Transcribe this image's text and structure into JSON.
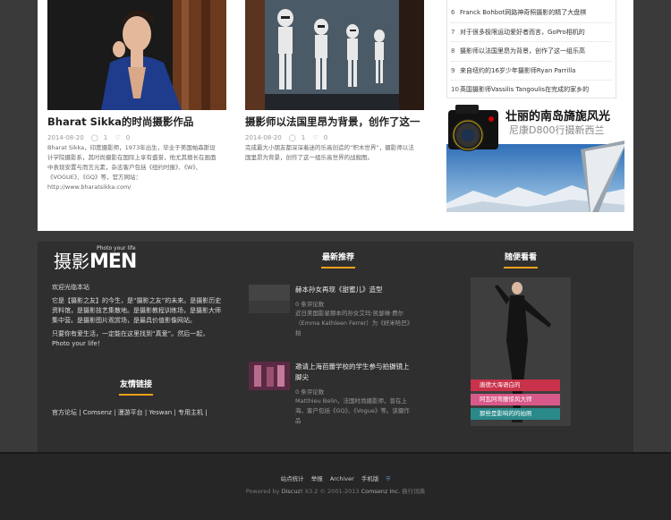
{
  "cards": [
    {
      "title": "Bharat Sikka的时尚摄影作品",
      "date": "2014-08-20",
      "comments": "1",
      "likes": "0",
      "description": "Bharat Sikka，印度摄影师，1973年出生，毕业于美国帕森斯设计学院摄影系，其时尚摄影在国际上享有盛誉，他尤其擅长在画面中表现安置与而言元素，杂志客户包括《纽约时报》、《W》、《VOGUE》、《GQ》等，官方网站：http://www.bharatsikka.com/"
    },
    {
      "title": "摄影师以法国里昂为背景，创作了这一",
      "date": "2014-08-20",
      "comments": "1",
      "likes": "0",
      "description": "完成最大小朋友都深深着迷的乐高创造的“积木世界”，摄影师以法国里昂为背景，创作了这一组乐高世界的战舰图。"
    }
  ],
  "rank": [
    {
      "num": "6",
      "text": "Franck Bohbot网路神奇照摄影的精了大盘棋"
    },
    {
      "num": "7",
      "text": "对于很多极限运动爱好者而言，GoPro相机的"
    },
    {
      "num": "8",
      "text": "摄影师以法国里昂为背景，创作了这一组乐高"
    },
    {
      "num": "9",
      "text": "来自纽约的16岁少年摄影师Ryan Parrilla"
    },
    {
      "num": "10",
      "text": "英国摄影师Vassilis Tangoulis在完成的家乡的"
    }
  ],
  "promo": {
    "headline": "壮丽的南岛旖旎风光",
    "subline": "尼康D800行摄新西兰"
  },
  "logo": {
    "cn": "摄影",
    "en": "MEN",
    "tagline": "Photo your life"
  },
  "intro": {
    "welcome": "欢迎光临本站",
    "p1": "它是【摄影之友】的今生，是“摄影之友”的未来。是摄影历史资料馆，是摄影技艺集散地。是摄影教程训练场，是摄影大师集中营。是摄影图片观赏场，是最具价值影像网站。",
    "p2": "只要你有爱生活，一定能在这里找到“真爱”。然后一起，Photo your life！"
  },
  "friend_links": {
    "title": "友情链接",
    "text": "官方论坛 | Comsenz | 漫游平台 | Yeswan | 专用主机 |"
  },
  "latest": {
    "title": "最新推荐",
    "items": [
      {
        "title": "赫本孙女再现《甜蜜儿》造型",
        "count": "0 条评论数",
        "description": "近日美国影星赫本的孙女艾玛·凯瑟琳·费尔（Emma Kathleen Ferrer）为《好米哈巴》拍"
      },
      {
        "title": "邀请上海芭蕾学校的学生参与拍摄镜上脚尖",
        "count": "0 条评论数",
        "description": "Matthieu Belin，法国时尚摄影师，曾在上海，客户包括《GQ》、《Vogue》等。该摄作品"
      }
    ]
  },
  "random": {
    "title": "随便看看",
    "labels": [
      "唐德大海语白的",
      "阿瓦阿弯腰惊风大师",
      "那些是影响的的拍照"
    ]
  },
  "footer": {
    "nav": [
      "站点统计",
      "举报",
      "Archiver",
      "手机版"
    ],
    "powered_prefix": "Powered by",
    "discuz": "Discuz!",
    "version": "X3.2",
    "rights": "© 2001-2013",
    "company": "Comsenz Inc.",
    "extra": "换行词典"
  },
  "colors": {
    "accent": "#f0a21b",
    "dark_bg": "#2f2f2f",
    "label_red": "#c9324a",
    "label_pink": "#d85a8a",
    "label_teal": "#2a8a8a"
  }
}
